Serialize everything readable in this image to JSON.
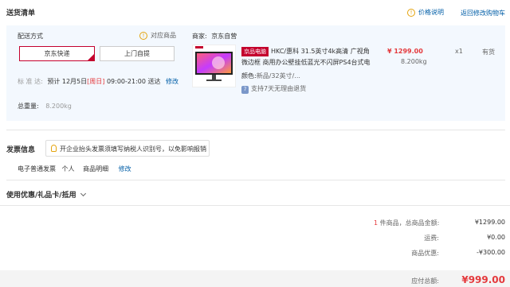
{
  "header": {
    "title": "送货清单",
    "price_note": "价格说明",
    "back_cart": "返回修改购物车"
  },
  "delivery": {
    "method_label": "配送方式",
    "supported_items": "对应商品",
    "options": [
      "京东快递",
      "上门自提"
    ],
    "selected": "京东快递",
    "standard_label": "标 准 达:",
    "expected_prefix": "预计",
    "date": "12月5日",
    "weekday": "[周日]",
    "time_window": "09:00-21:00 送达",
    "edit": "修改",
    "total_weight_label": "总重量:",
    "total_weight": "8.200kg"
  },
  "merchant": {
    "label": "商家:",
    "name": "京东自营"
  },
  "product": {
    "tag": "京品电脑",
    "title_line1": "HKC/惠科 31.5英寸4k高清 广视角",
    "title_line2": "微边框 商用办公壁挂低蓝光不闪屏PS4台式电",
    "color_label": "颜色:",
    "color_value": "新品/32英寸/...",
    "service": "支持7天无理由退货",
    "price": "¥ 1299.00",
    "weight": "8.200kg",
    "qty": "x1",
    "stock": "有货"
  },
  "invoice": {
    "title": "发票信息",
    "tip": "开企业抬头发票须填写纳税人识别号，以免影响报销",
    "type": "电子普通发票",
    "holder": "个人",
    "detail": "商品明细",
    "edit": "修改"
  },
  "coupon": {
    "title": "使用优惠/礼品卡/抵用"
  },
  "summary": {
    "count": "1",
    "count_suffix": "件商品，总商品金额:",
    "goods_total": "¥1299.00",
    "shipping_label": "运费:",
    "shipping": "¥0.00",
    "discount_label": "商品优惠:",
    "discount": "-¥300.00",
    "payable_label": "应付总额:",
    "payable": "¥999.00"
  },
  "colors": {
    "brand_red": "#e4393c",
    "deep_red": "#c4002d",
    "link_blue": "#005ea7",
    "panel_bg": "#f3f8fe"
  }
}
